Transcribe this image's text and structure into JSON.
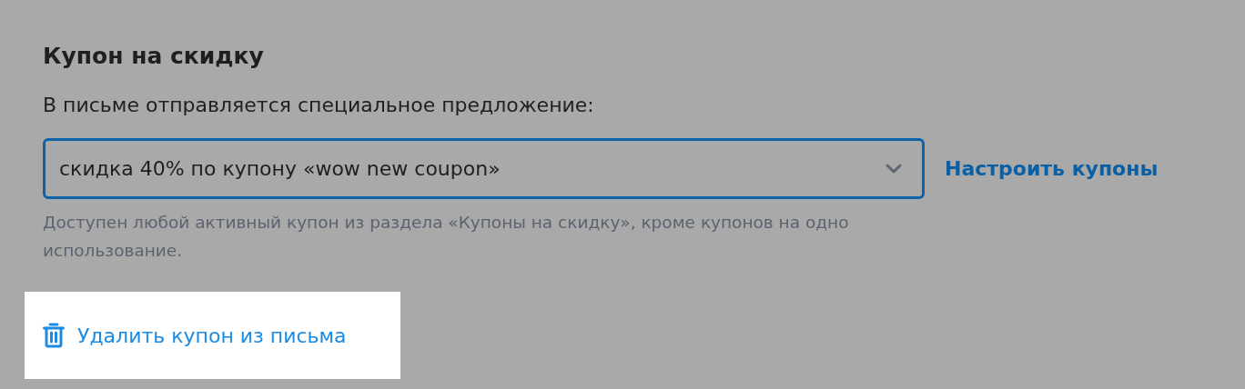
{
  "section": {
    "title": "Купон на скидку",
    "label": "В письме отправляется специальное предложение:"
  },
  "coupon_select": {
    "value": "скидка 40% по купону «wow new coupon»",
    "focused": true
  },
  "configure_link": "Настроить купоны",
  "hint": "Доступен любой активный купон из раздела «Купоны на скидку», кроме купонов на одно использование.",
  "remove_link": {
    "label": "Удалить купон из письма",
    "highlighted": true
  }
}
